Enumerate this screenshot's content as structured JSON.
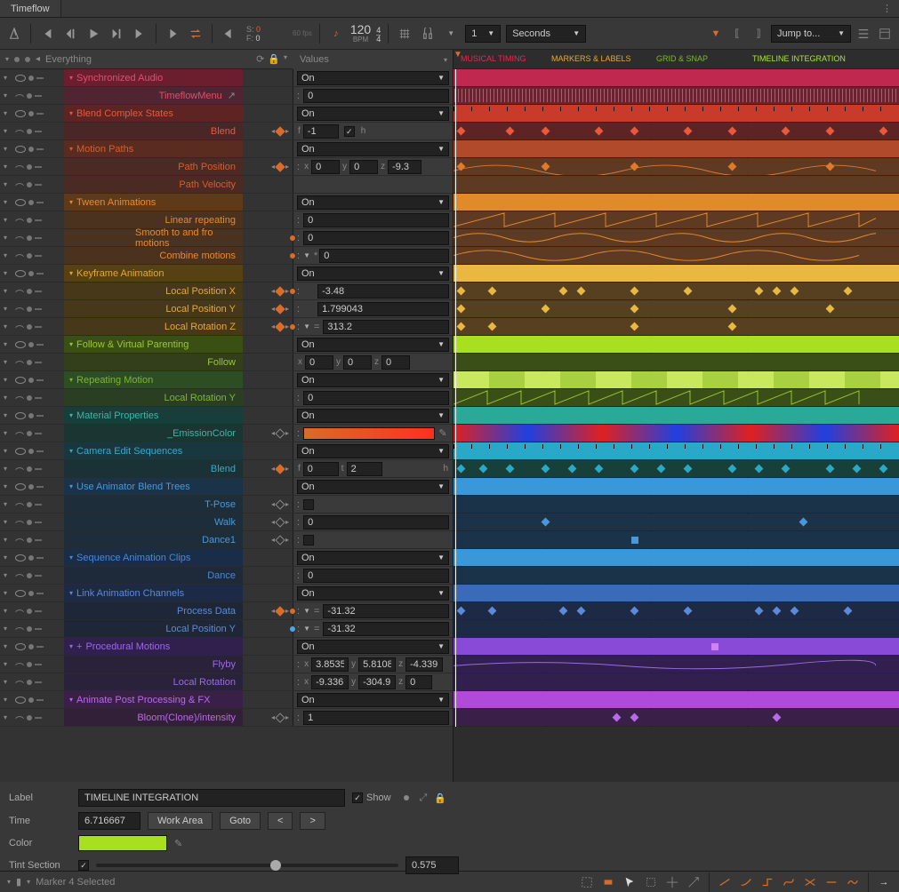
{
  "titlebar": {
    "title": "Timeflow"
  },
  "toolbar": {
    "s_label": "S:",
    "s_value": "0",
    "f_label": "F:",
    "f_value": "0",
    "fps": "60 fps",
    "bpm_value": "120",
    "bpm_label": "BPM",
    "sig_top": "4",
    "sig_bot": "4",
    "time_num": "1",
    "time_unit": "Seconds",
    "jump": "Jump to..."
  },
  "panel_header": {
    "text": "Everything",
    "values": "Values"
  },
  "tl_labels": {
    "musical": "MUSICAL TIMING",
    "markers": "MARKERS & LABELS",
    "grid": "GRID & SNAP",
    "timeline": "TIMELINE INTEGRATION"
  },
  "sections": {
    "sync_audio": "Synchronized Audio",
    "timeflow_menu": "TimeflowMenu",
    "blend_states": "Blend Complex States",
    "blend": "Blend",
    "motion_paths": "Motion Paths",
    "path_position": "Path Position",
    "path_velocity": "Path Velocity",
    "tween": "Tween Animations",
    "linear_rep": "Linear repeating",
    "smooth_to": "Smooth to and fro motions",
    "combine": "Combine motions",
    "keyframe": "Keyframe Animation",
    "local_pos_x": "Local Position X",
    "local_pos_y": "Local Position Y",
    "local_rot_z": "Local Rotation Z",
    "follow_vp": "Follow & Virtual Parenting",
    "follow": "Follow",
    "repeating": "Repeating Motion",
    "local_rot_y": "Local Rotation Y",
    "material": "Material Properties",
    "emission": "_EmissionColor",
    "camera": "Camera Edit Sequences",
    "camera_blend": "Blend",
    "blend_trees": "Use Animator Blend Trees",
    "tpose": "T-Pose",
    "walk": "Walk",
    "dance1": "Dance1",
    "seq_clips": "Sequence Animation Clips",
    "dance": "Dance",
    "link_chan": "Link Animation Channels",
    "process_data": "Process Data",
    "link_local_pos_y": "Local Position Y",
    "procedural": "Procedural Motions",
    "flyby": "Flyby",
    "local_rotation": "Local Rotation",
    "post_fx": "Animate Post Processing & FX",
    "bloom": "Bloom(Clone)/intensity"
  },
  "values": {
    "on": "On",
    "zero": "0",
    "f_neg1": "-1",
    "h": "h",
    "x0": "0",
    "y0": "0",
    "z_neg93": "-9.3",
    "neg348": "-3.48",
    "v1799": "1.799043",
    "v3132": "313.2",
    "t2": "2",
    "neg3132": "-31.32",
    "x38535": "3.8535",
    "y58108": "5.8108",
    "z_neg4339": "-4.339",
    "x_neg9336": "-9.336",
    "y_neg3049": "-304.9",
    "z0": "0",
    "one": "1"
  },
  "bottom": {
    "label": "Label",
    "label_val": "TIMELINE INTEGRATION",
    "show": "Show",
    "time": "Time",
    "time_val": "6.716667",
    "work_area": "Work Area",
    "goto": "Goto",
    "prev": "<",
    "next": ">",
    "color": "Color",
    "tint": "Tint Section",
    "tint_val": "0.575"
  },
  "status": {
    "marker": "Marker 4 Selected"
  }
}
